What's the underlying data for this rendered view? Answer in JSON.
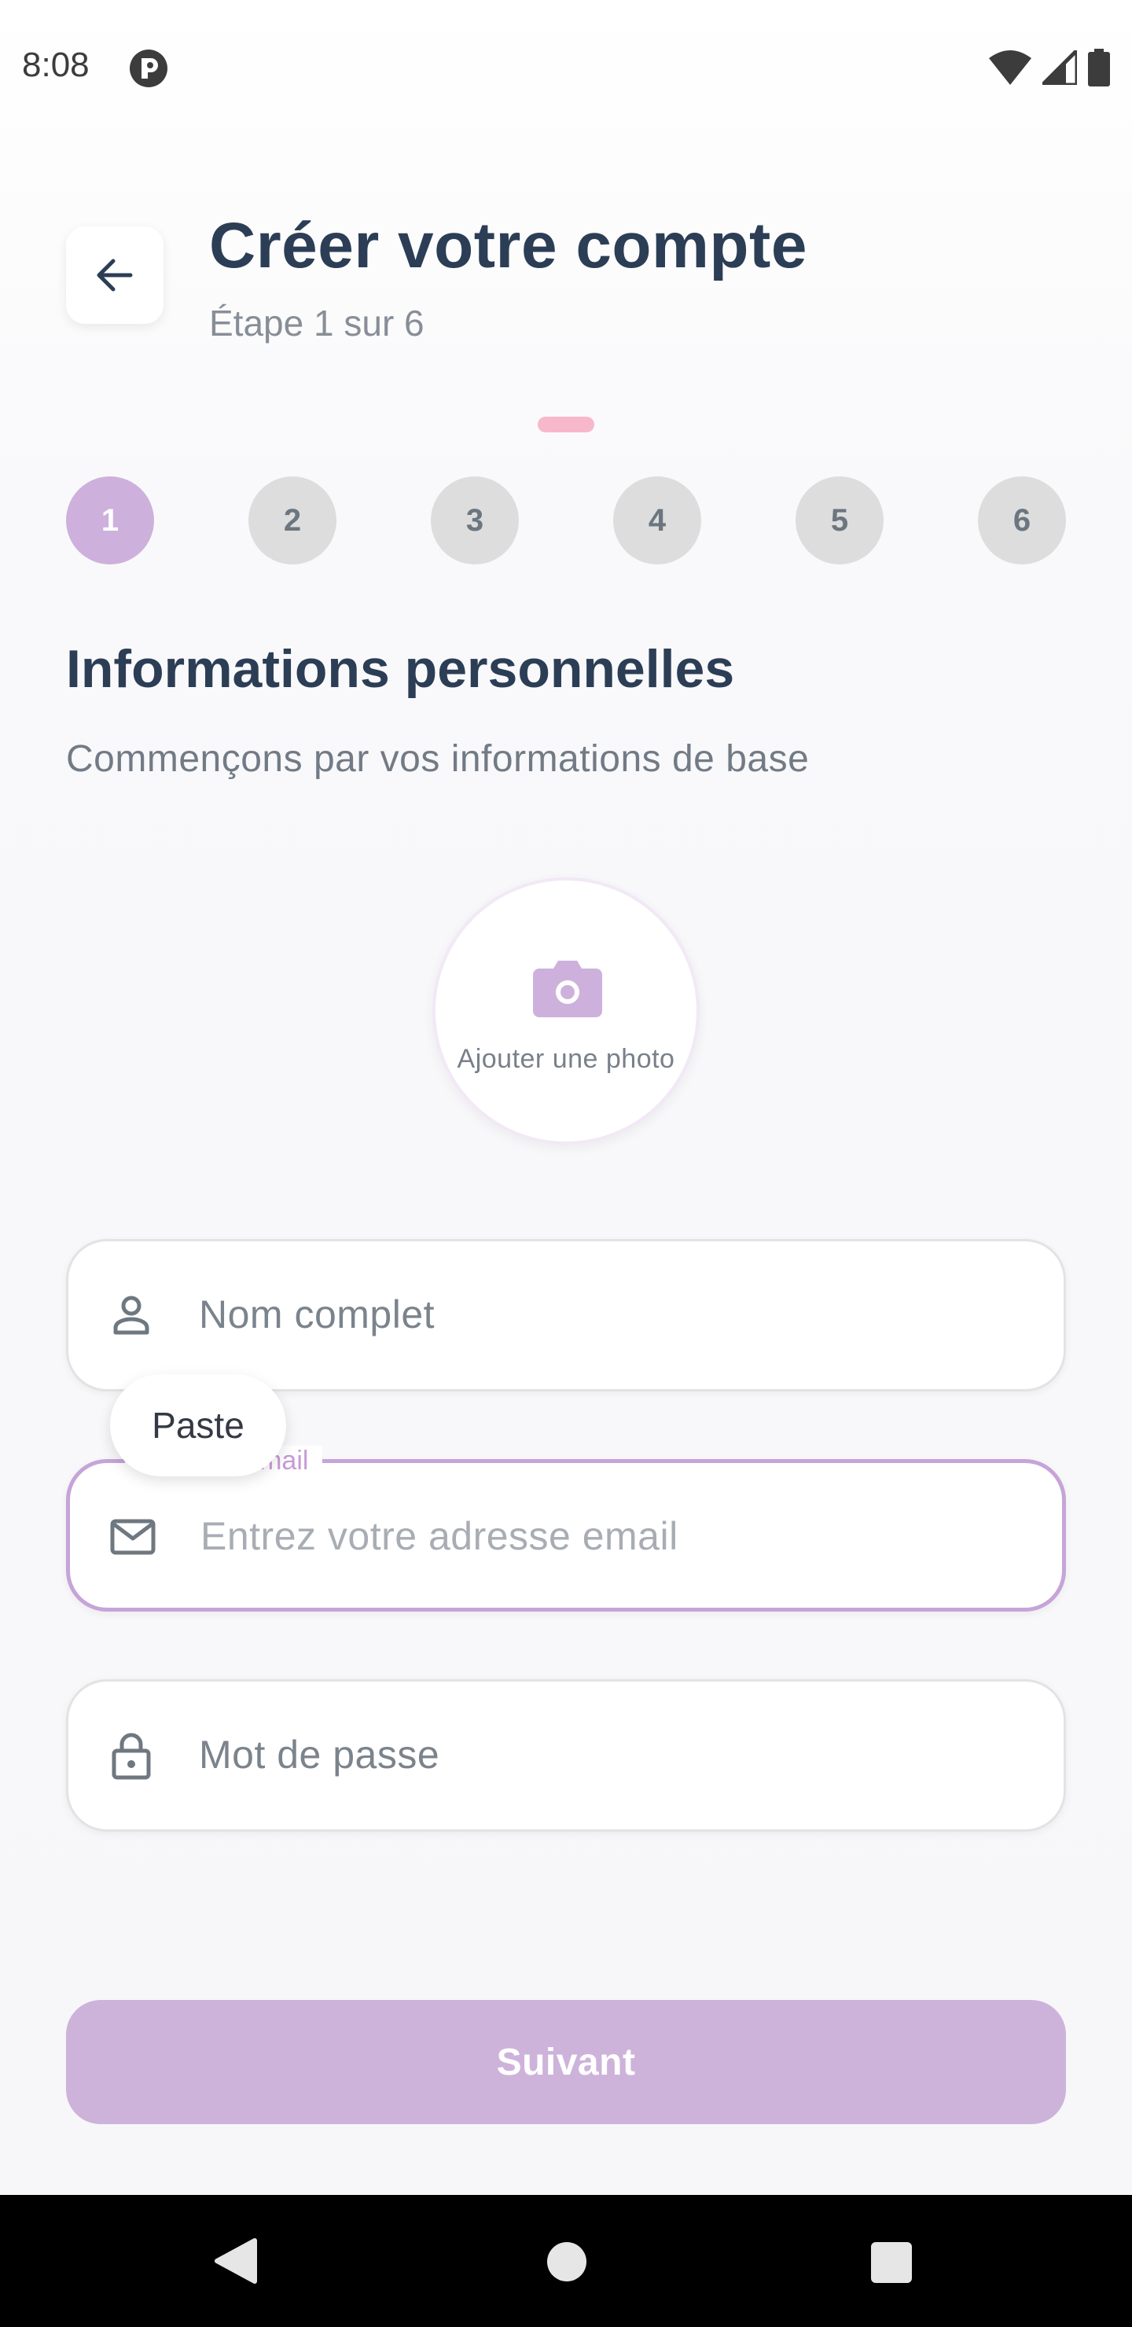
{
  "status_bar": {
    "time": "8:08",
    "app_icon": "app-notification-icon",
    "icons": [
      "wifi-icon",
      "signal-icon",
      "battery-icon"
    ]
  },
  "header": {
    "back_icon": "arrow-left-icon",
    "title": "Créer votre compte",
    "step_text": "Étape 1 sur 6"
  },
  "stepper": {
    "steps": [
      "1",
      "2",
      "3",
      "4",
      "5",
      "6"
    ],
    "current_step": 1
  },
  "section": {
    "title": "Informations personnelles",
    "subtitle": "Commençons par vos informations de base"
  },
  "photo": {
    "icon": "camera-icon",
    "label": "Ajouter une photo"
  },
  "form": {
    "name_field": {
      "icon": "person-icon",
      "placeholder": "Nom complet"
    },
    "email_field": {
      "icon": "mail-icon",
      "label": "Adresse email",
      "placeholder": "Entrez votre adresse email"
    },
    "password_field": {
      "icon": "lock-icon",
      "placeholder": "Mot de passe"
    }
  },
  "paste_popup": {
    "label": "Paste"
  },
  "next_button": {
    "label": "Suivant"
  },
  "colors": {
    "accent": "#cdb1dc",
    "title": "#2c3e55",
    "email_label": "#c89ad8",
    "drag_indicator": "#f8b8cc"
  }
}
